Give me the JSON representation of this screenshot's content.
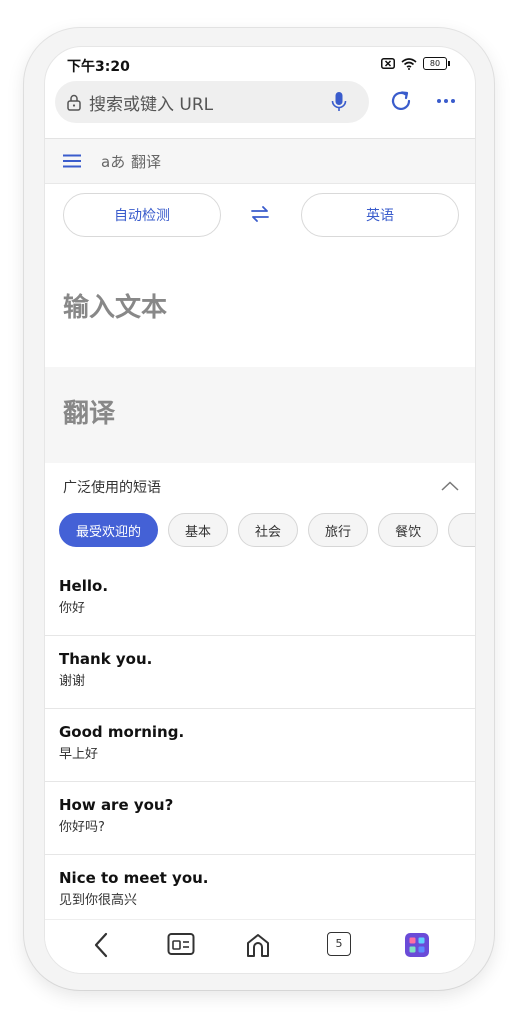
{
  "status_bar": {
    "time": "下午3:20",
    "battery": "80"
  },
  "url_bar": {
    "placeholder": "搜索或键入 URL"
  },
  "translator": {
    "logo_text": "aあ",
    "title": "翻译",
    "source_language": "自动检测",
    "target_language": "英语",
    "input_placeholder": "输入文本",
    "output_placeholder": "翻译"
  },
  "phrases": {
    "section_title": "广泛使用的短语",
    "categories": [
      {
        "label": "最受欢迎的",
        "active": true
      },
      {
        "label": "基本",
        "active": false
      },
      {
        "label": "社会",
        "active": false
      },
      {
        "label": "旅行",
        "active": false
      },
      {
        "label": "餐饮",
        "active": false
      }
    ],
    "items": [
      {
        "en": "Hello.",
        "zh": "你好"
      },
      {
        "en": "Thank you.",
        "zh": "谢谢"
      },
      {
        "en": "Good morning.",
        "zh": "早上好"
      },
      {
        "en": "How are you?",
        "zh": "你好吗?"
      },
      {
        "en": "Nice to meet you.",
        "zh": "见到你很高兴"
      }
    ]
  },
  "bottom_nav": {
    "tab_count": "5"
  },
  "colors": {
    "accent": "#3a5ccc",
    "chip_active": "#4461d6"
  },
  "icons": [
    "lock-icon",
    "mic-icon",
    "reload-icon",
    "more-icon",
    "menu-icon",
    "swap-icon",
    "chevron-up-icon",
    "back-icon",
    "reader-icon",
    "home-icon",
    "tabs-icon",
    "apps-icon"
  ]
}
